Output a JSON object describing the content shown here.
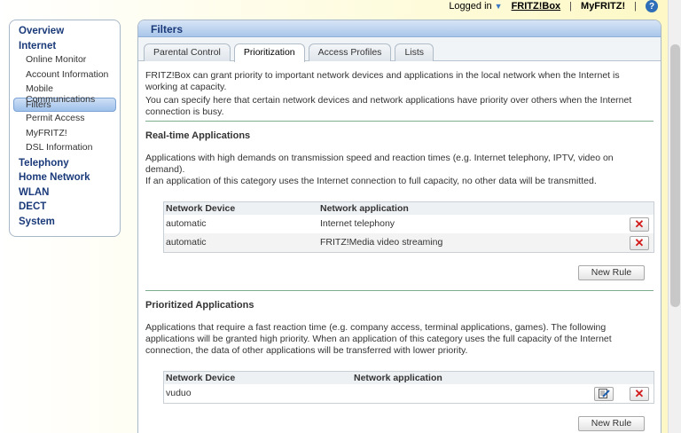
{
  "topbar": {
    "logged_in": "Logged in",
    "fritzbox": "FRITZ!Box",
    "myfritz": "MyFRITZ!",
    "help": "?",
    "sep": "|"
  },
  "sidebar": {
    "items": [
      {
        "label": "Overview",
        "level": "top"
      },
      {
        "label": "Internet",
        "level": "top"
      },
      {
        "label": "Online Monitor",
        "level": "sub"
      },
      {
        "label": "Account Information",
        "level": "sub"
      },
      {
        "label": "Mobile Communications",
        "level": "sub"
      },
      {
        "label": "Filters",
        "level": "sub",
        "active": true
      },
      {
        "label": "Permit Access",
        "level": "sub"
      },
      {
        "label": "MyFRITZ!",
        "level": "sub"
      },
      {
        "label": "DSL Information",
        "level": "sub"
      },
      {
        "label": "Telephony",
        "level": "top"
      },
      {
        "label": "Home Network",
        "level": "top"
      },
      {
        "label": "WLAN",
        "level": "top"
      },
      {
        "label": "DECT",
        "level": "top"
      },
      {
        "label": "System",
        "level": "top"
      }
    ]
  },
  "main": {
    "title": "Filters",
    "tabs": [
      {
        "label": "Parental Control"
      },
      {
        "label": "Prioritization",
        "active": true
      },
      {
        "label": "Access Profiles"
      },
      {
        "label": "Lists"
      }
    ],
    "intro1": "FRITZ!Box can grant priority to important network devices and applications in the local network when the Internet is working at capacity.",
    "intro2": "You can specify here that certain network devices and network applications have priority over others when the Internet connection is busy.",
    "realtime": {
      "heading": "Real-time Applications",
      "desc1": "Applications with high demands on transmission speed and reaction times (e.g. Internet telephony, IPTV, video on demand).",
      "desc2": "If an application of this category uses the Internet connection to full capacity, no other data will be transmitted.",
      "col_device": "Network Device",
      "col_app": "Network application",
      "rows": [
        {
          "device": "automatic",
          "app": "Internet telephony"
        },
        {
          "device": "automatic",
          "app": "FRITZ!Media video streaming"
        }
      ],
      "new_rule": "New Rule"
    },
    "prioritized": {
      "heading": "Prioritized Applications",
      "desc": "Applications that require a fast reaction time (e.g. company access, terminal applications, games). The following applications will be granted high priority. When an application of this category uses the full capacity of the Internet connection, the data of other applications will be transferred with lower priority.",
      "col_device": "Network Device",
      "col_app": "Network application",
      "rows": [
        {
          "device": "vuduo",
          "app": ""
        }
      ],
      "new_rule": "New Rule"
    },
    "delete_glyph": "✕"
  }
}
